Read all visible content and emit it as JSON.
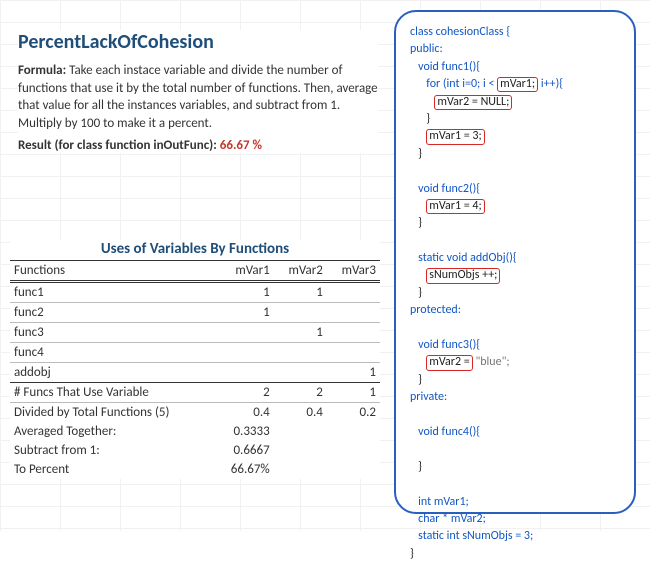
{
  "title": "PercentLackOfCohesion",
  "formula": {
    "label": "Formula:",
    "text": "Take each instace variable and divide the number of functions that use it by the total number of functions. Then, average that value for all the instances variables, and subtract from 1. Multiply by 100 to make it a percent."
  },
  "result": {
    "label": "Result (for class function inOutFunc):",
    "value": "66.67 %"
  },
  "table": {
    "title": "Uses of Variables By Functions",
    "headers": [
      "Functions",
      "mVar1",
      "mVar2",
      "mVar3"
    ],
    "rows": [
      {
        "label": "func1",
        "v": [
          "1",
          "1",
          ""
        ]
      },
      {
        "label": "func2",
        "v": [
          "1",
          "",
          ""
        ]
      },
      {
        "label": "func3",
        "v": [
          "",
          "1",
          ""
        ]
      },
      {
        "label": "func4",
        "v": [
          "",
          "",
          ""
        ]
      },
      {
        "label": "addobj",
        "v": [
          "",
          "",
          "1"
        ]
      }
    ],
    "summary": [
      {
        "label": "# Funcs That Use Variable",
        "v": [
          "2",
          "2",
          "1"
        ]
      },
      {
        "label": "Divided by Total Functions (5)",
        "v": [
          "0.4",
          "0.4",
          "0.2"
        ]
      },
      {
        "label": "Averaged Together:",
        "v": [
          "0.3333",
          "",
          ""
        ]
      },
      {
        "label": "Subtract from 1:",
        "v": [
          "0.6667",
          "",
          ""
        ]
      },
      {
        "label": "To Percent",
        "v": [
          "66.67%",
          "",
          ""
        ]
      }
    ]
  },
  "code": {
    "class_decl": "class cohesionClass {",
    "public": "public:",
    "protected": "protected:",
    "private": "private:",
    "func1_sig": "void func1(){",
    "for_pre": "for (int i=0; i <",
    "for_post": "i++){",
    "mvar1": "mVar1;",
    "mvar1_eq3": "mVar1 = 3;",
    "mvar2_null": "mVar2 = NULL;",
    "func2_sig": "void func2(){",
    "mvar1_eq4": "mVar1 = 4;",
    "addobj_sig": "static void addObj(){",
    "snumobjs": "sNumObjs ++;",
    "func3_sig": "void func3(){",
    "mvar2_blue_lhs": "mVar2 =",
    "mvar2_blue_rhs": "\"blue\";",
    "func4_sig": "void func4(){",
    "decl_mvar1": "int mVar1;",
    "decl_mvar2": "char * mVar2;",
    "decl_snum": "static int sNumObjs = 3;",
    "brace_close": "}"
  },
  "chart_data": {
    "type": "table",
    "title": "Uses of Variables By Functions",
    "columns": [
      "Functions",
      "mVar1",
      "mVar2",
      "mVar3"
    ],
    "rows": [
      [
        "func1",
        1,
        1,
        null
      ],
      [
        "func2",
        1,
        null,
        null
      ],
      [
        "func3",
        null,
        1,
        null
      ],
      [
        "func4",
        null,
        null,
        null
      ],
      [
        "addobj",
        null,
        null,
        1
      ],
      [
        "# Funcs That Use Variable",
        2,
        2,
        1
      ],
      [
        "Divided by Total Functions (5)",
        0.4,
        0.4,
        0.2
      ],
      [
        "Averaged Together:",
        0.3333,
        null,
        null
      ],
      [
        "Subtract from 1:",
        0.6667,
        null,
        null
      ],
      [
        "To Percent",
        "66.67%",
        null,
        null
      ]
    ]
  }
}
